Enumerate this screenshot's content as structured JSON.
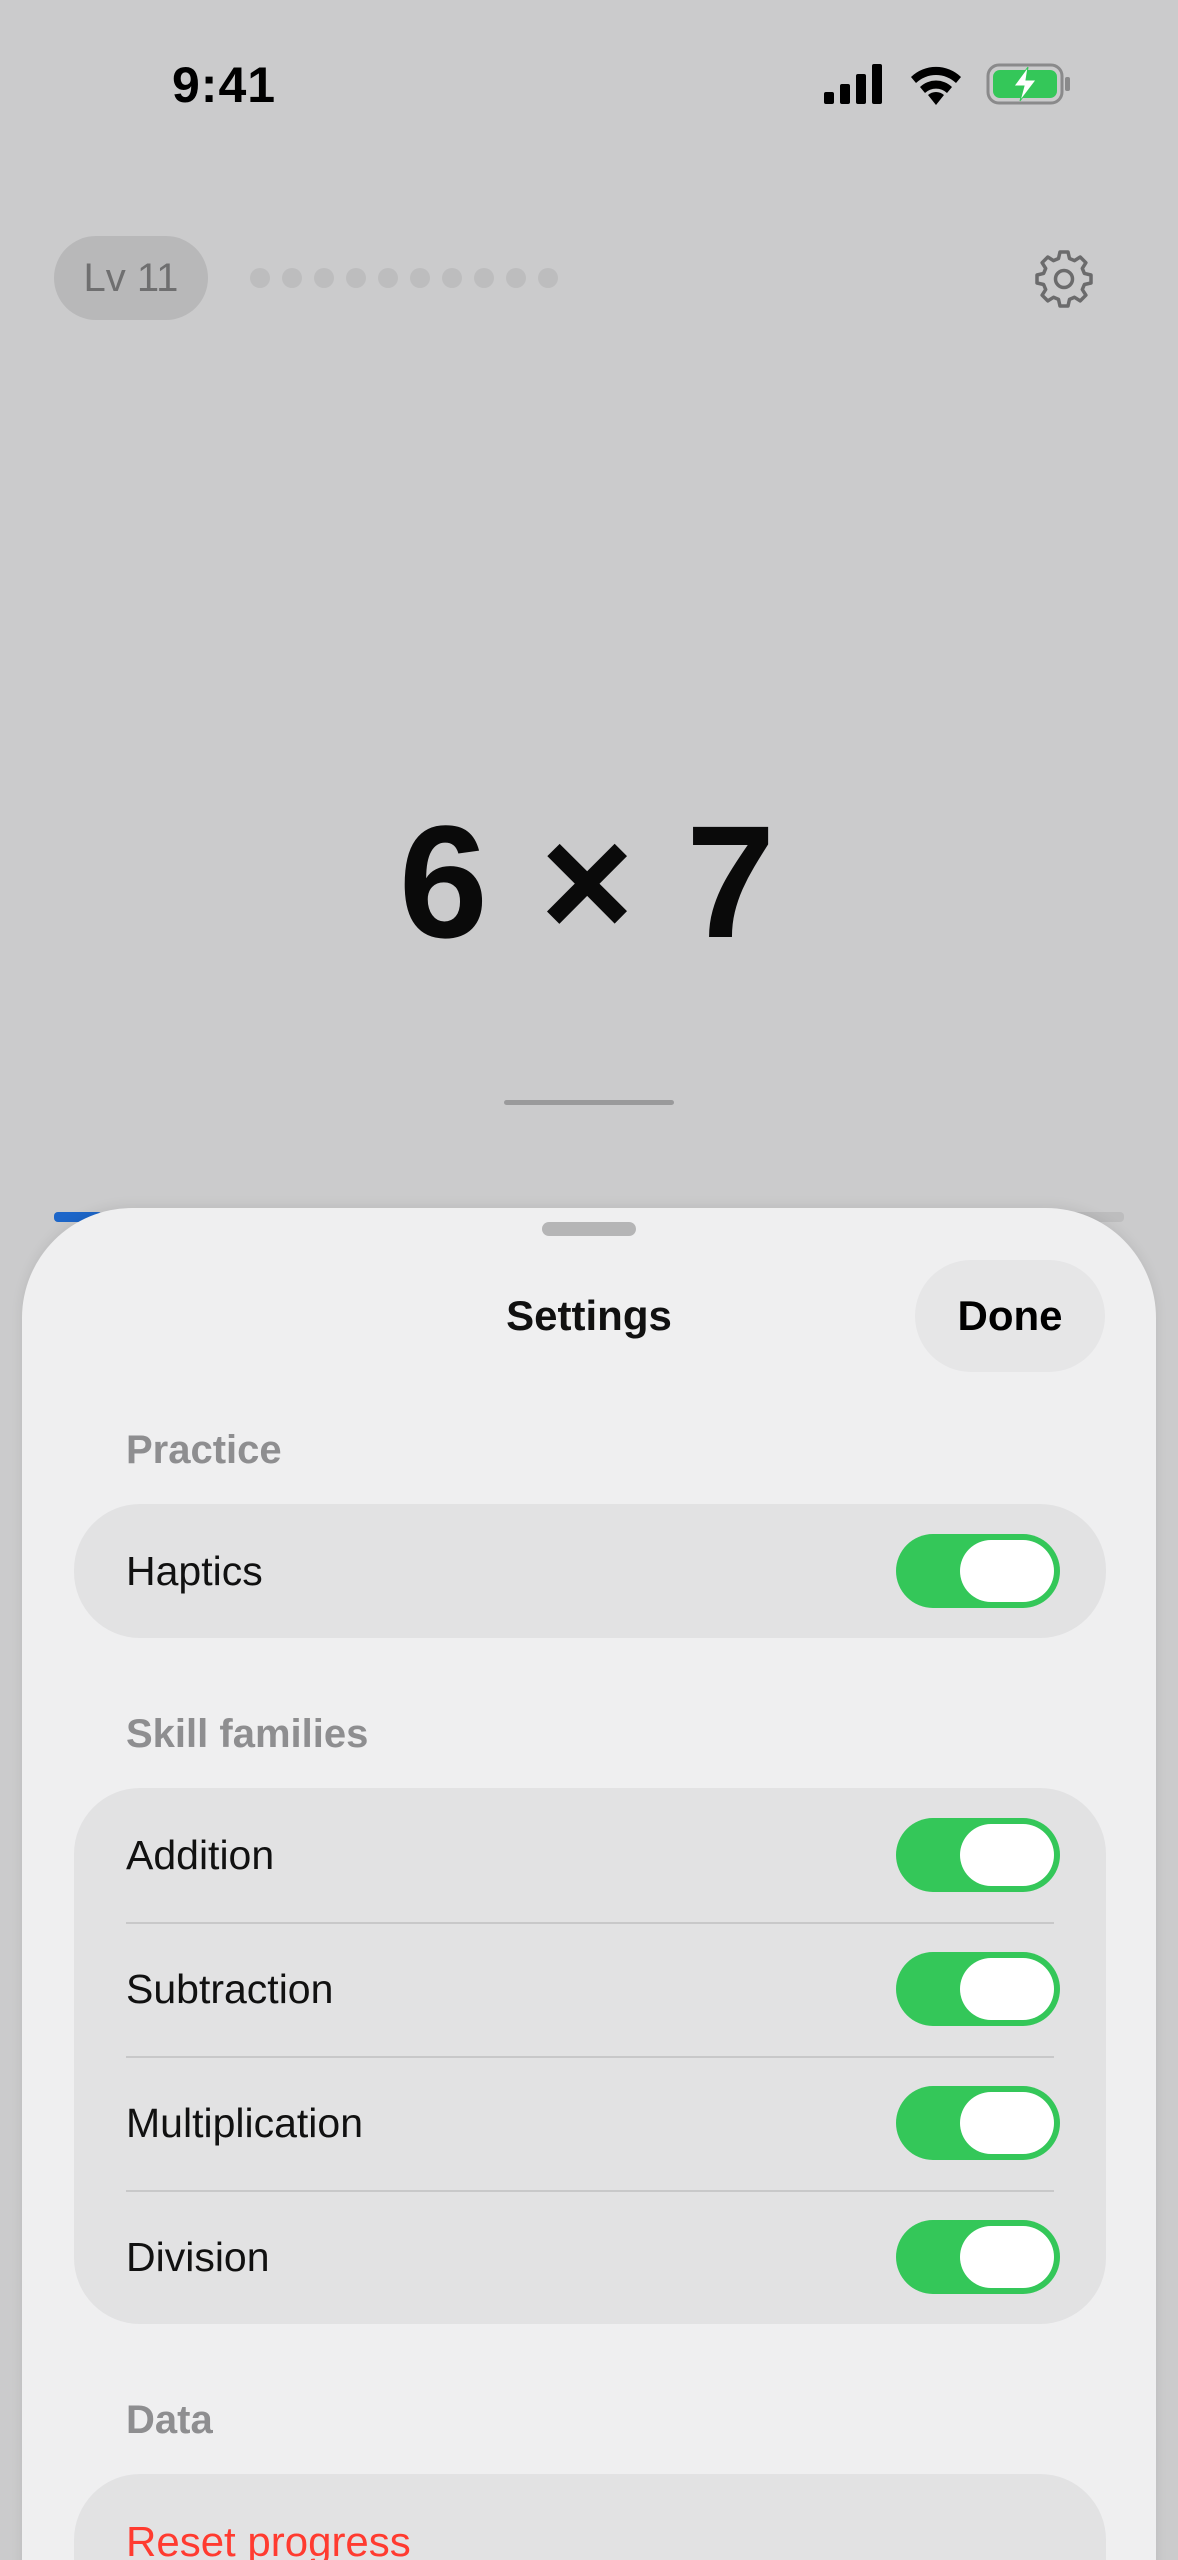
{
  "status_bar": {
    "time": "9:41",
    "icons": [
      "signal-icon",
      "wifi-icon",
      "battery-charging-icon"
    ],
    "battery_color": "#34c759"
  },
  "top_bar": {
    "level_label": "Lv 11",
    "progress_dots_count": 10,
    "settings_icon": "gear-icon"
  },
  "problem": {
    "text": "6 × 7"
  },
  "sheet": {
    "title": "Settings",
    "done_label": "Done",
    "sections": [
      {
        "header": "Practice",
        "rows": [
          {
            "label": "Haptics",
            "on": true
          }
        ]
      },
      {
        "header": "Skill families",
        "rows": [
          {
            "label": "Addition",
            "on": true
          },
          {
            "label": "Subtraction",
            "on": true
          },
          {
            "label": "Multiplication",
            "on": true
          },
          {
            "label": "Division",
            "on": true
          }
        ]
      },
      {
        "header": "Data",
        "rows": [
          {
            "label": "Reset progress"
          }
        ]
      }
    ],
    "toggle_on_color": "#34c759",
    "destructive_color": "#ff3b30"
  }
}
